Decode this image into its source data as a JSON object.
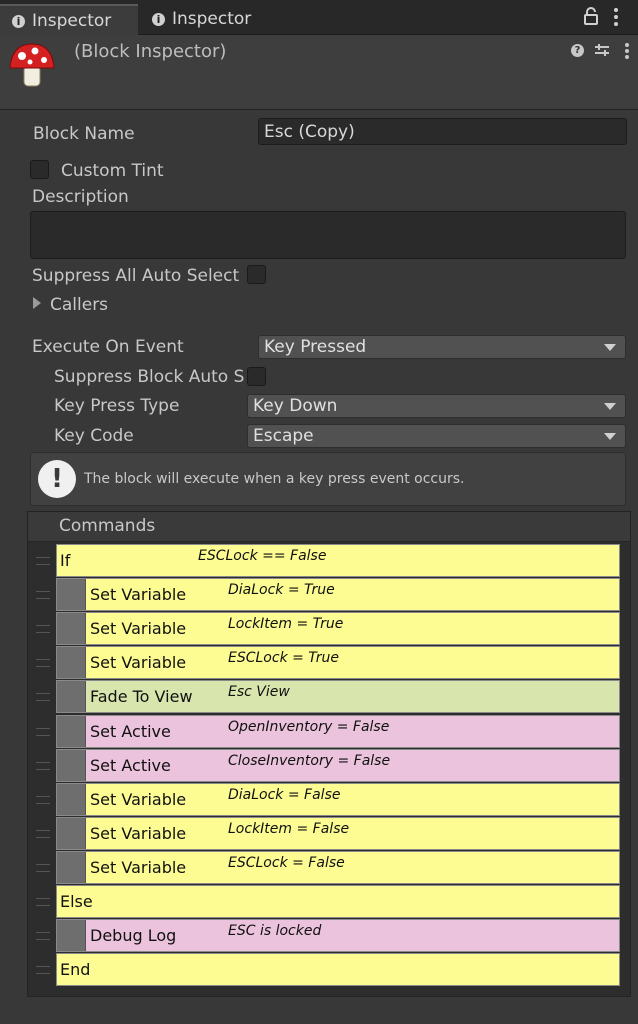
{
  "tabs": [
    {
      "label": "Inspector",
      "active": true
    },
    {
      "label": "Inspector",
      "active": false
    }
  ],
  "header": {
    "title": "(Block Inspector)"
  },
  "block_name": {
    "label": "Block Name",
    "value": "Esc (Copy)"
  },
  "custom_tint": {
    "label": "Custom Tint",
    "checked": false
  },
  "description": {
    "label": "Description",
    "value": ""
  },
  "suppress_all": {
    "label": "Suppress All Auto Select",
    "checked": false
  },
  "callers": {
    "label": "Callers"
  },
  "execute_on_event": {
    "label": "Execute On Event",
    "value": "Key Pressed"
  },
  "suppress_block": {
    "label": "Suppress Block Auto S",
    "checked": false
  },
  "key_press_type": {
    "label": "Key Press Type",
    "value": "Key Down"
  },
  "key_code": {
    "label": "Key Code",
    "value": "Escape"
  },
  "help": {
    "text": "The block will execute when a key press event occurs."
  },
  "commands": {
    "title": "Commands",
    "rows": [
      {
        "name": "If",
        "summary": "ESCLock == False",
        "indent": 0,
        "color": "#fdfc92"
      },
      {
        "name": "Set Variable",
        "summary": "DiaLock = True",
        "indent": 1,
        "color": "#fdfc92"
      },
      {
        "name": "Set Variable",
        "summary": "LockItem = True",
        "indent": 1,
        "color": "#fdfc92"
      },
      {
        "name": "Set Variable",
        "summary": "ESCLock = True",
        "indent": 1,
        "color": "#fdfc92"
      },
      {
        "name": "Fade To View",
        "summary": "Esc View",
        "indent": 1,
        "color": "#d8e5ad"
      },
      {
        "name": "Set Active",
        "summary": "OpenInventory = False",
        "indent": 1,
        "color": "#ebc3dc"
      },
      {
        "name": "Set Active",
        "summary": "CloseInventory = False",
        "indent": 1,
        "color": "#ebc3dc"
      },
      {
        "name": "Set Variable",
        "summary": "DiaLock = False",
        "indent": 1,
        "color": "#fdfc92"
      },
      {
        "name": "Set Variable",
        "summary": "LockItem = False",
        "indent": 1,
        "color": "#fdfc92"
      },
      {
        "name": "Set Variable",
        "summary": "ESCLock = False",
        "indent": 1,
        "color": "#fdfc92"
      },
      {
        "name": "Else",
        "summary": "",
        "indent": 0,
        "color": "#fdfc92"
      },
      {
        "name": "Debug Log",
        "summary": "ESC is locked",
        "indent": 1,
        "color": "#ebc3dc"
      },
      {
        "name": "End",
        "summary": "",
        "indent": 0,
        "color": "#fdfc92"
      }
    ]
  }
}
